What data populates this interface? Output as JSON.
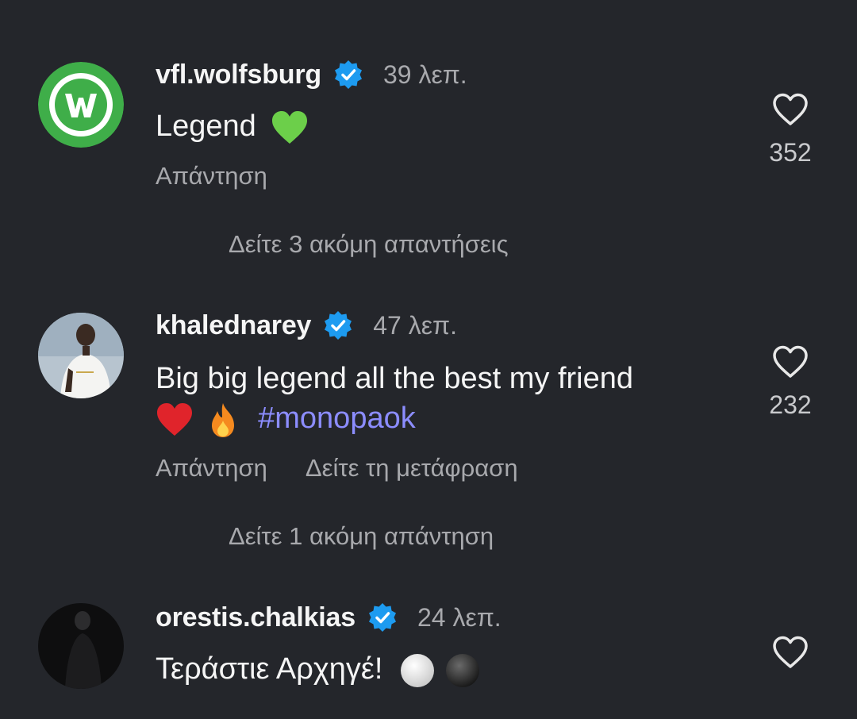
{
  "comments": [
    {
      "username": "vfl.wolfsburg",
      "time": "39 λεπ.",
      "text": "Legend",
      "reply_label": "Απάντηση",
      "like_count": "352",
      "avatar": "wolfsburg-logo"
    },
    {
      "username": "khalednarey",
      "time": "47 λεπ.",
      "text_line1": "Big big legend all the best my friend",
      "hashtag": "#monopaok",
      "reply_label": "Απάντηση",
      "translate_label": "Δείτε τη μετάφραση",
      "like_count": "232",
      "avatar": "player-photo"
    },
    {
      "username": "orestis.chalkias",
      "time": "24 λεπ.",
      "text": "Τεράστιε Αρχηγέ!",
      "like_count": "",
      "avatar": "portrait-photo"
    }
  ],
  "more_replies": [
    "Δείτε 3 ακόμη απαντήσεις",
    "Δείτε 1 ακόμη απάντηση"
  ],
  "icons": {
    "verified": "verified-badge-icon",
    "like": "heart-outline-icon",
    "emojis": [
      "green-heart",
      "red-heart",
      "fire",
      "white-circle",
      "black-circle"
    ]
  },
  "colors": {
    "background": "#24262b",
    "verified": "#1d9bf0",
    "hashtag": "#8c8dff",
    "secondary_text": "#a8a9ad"
  }
}
